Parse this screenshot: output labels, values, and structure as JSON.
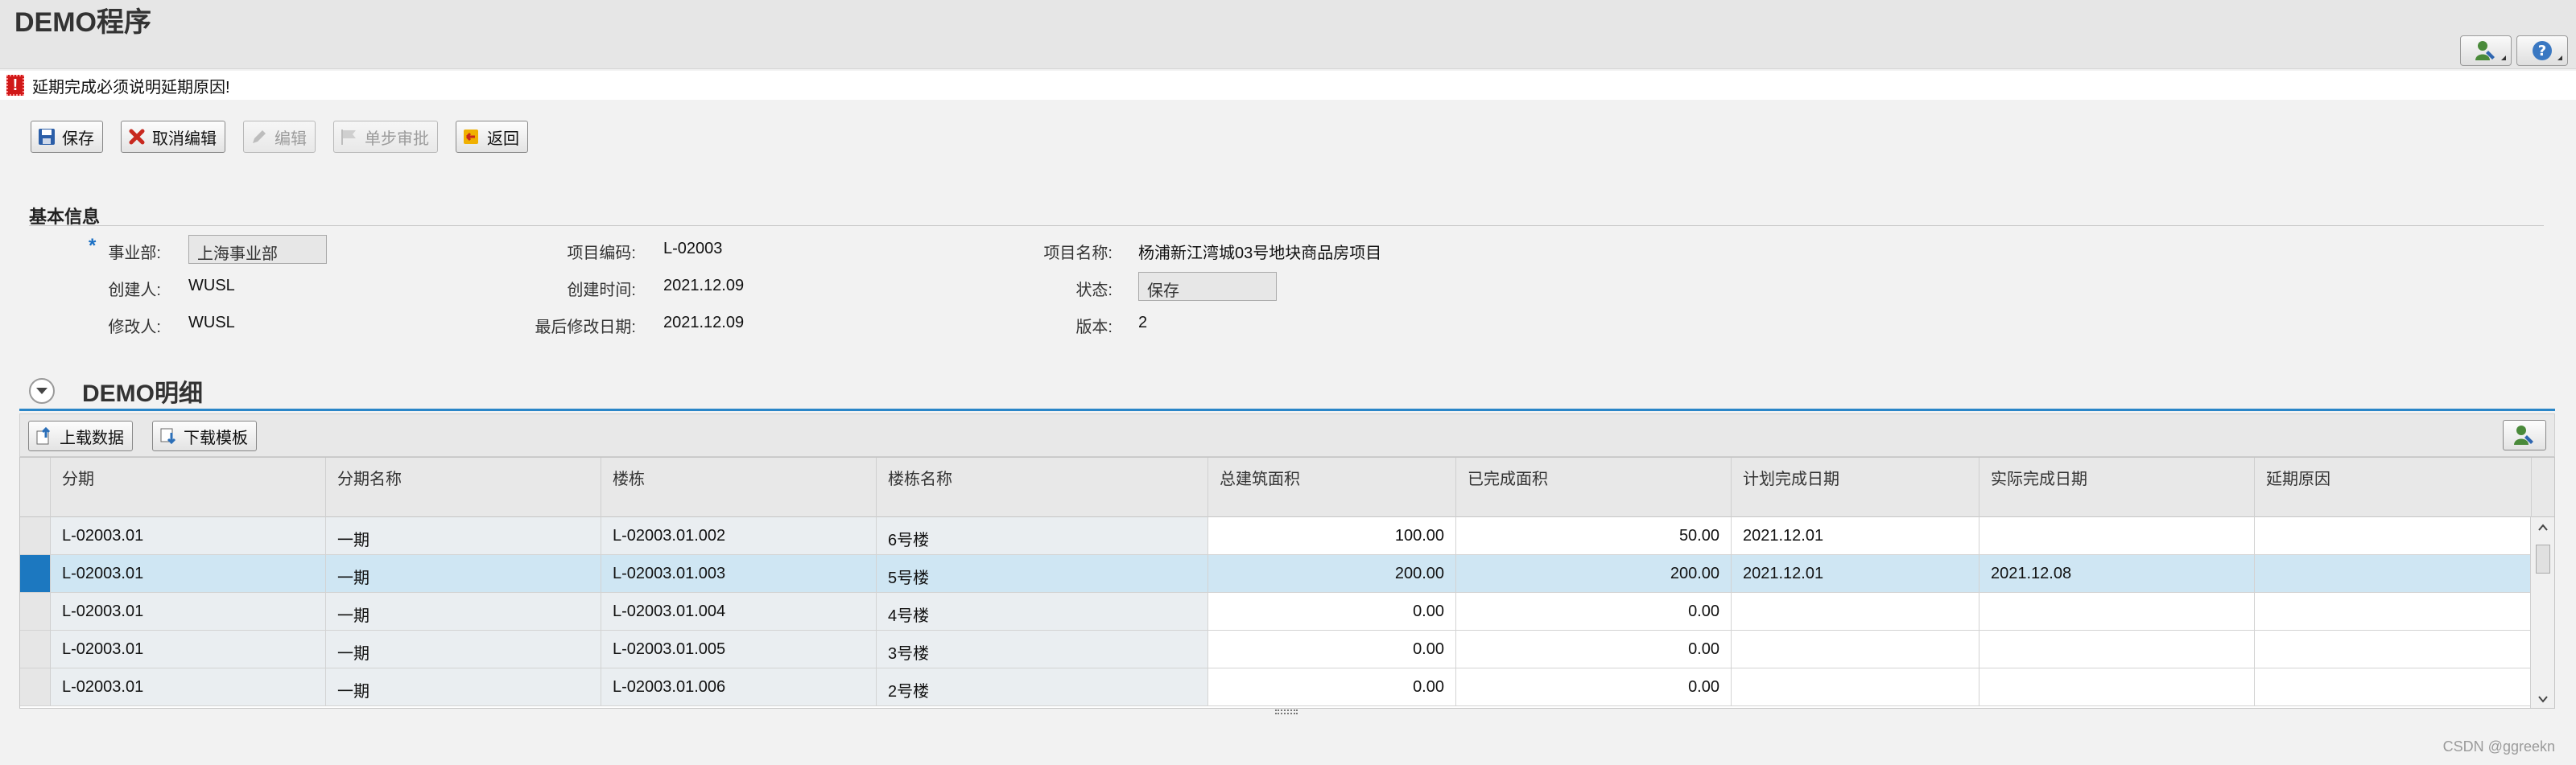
{
  "app": {
    "title": "DEMO程序"
  },
  "message": {
    "text": "延期完成必须说明延期原因!"
  },
  "toolbar": {
    "save": "保存",
    "cancel_edit": "取消编辑",
    "edit": "编辑",
    "single_approve": "单步审批",
    "back": "返回"
  },
  "basic_info": {
    "title": "基本信息",
    "business_unit_label": "事业部:",
    "business_unit_value": "上海事业部",
    "project_code_label": "项目编码:",
    "project_code_value": "L-02003",
    "project_name_label": "项目名称:",
    "project_name_value": "杨浦新江湾城03号地块商品房项目",
    "creator_label": "创建人:",
    "creator_value": "WUSL",
    "created_time_label": "创建时间:",
    "created_time_value": "2021.12.09",
    "status_label": "状态:",
    "status_value": "保存",
    "modifier_label": "修改人:",
    "modifier_value": "WUSL",
    "last_modified_label": "最后修改日期:",
    "last_modified_value": "2021.12.09",
    "version_label": "版本:",
    "version_value": "2"
  },
  "detail": {
    "title": "DEMO明细",
    "upload_label": "上载数据",
    "download_label": "下载模板",
    "columns": [
      "分期",
      "分期名称",
      "楼栋",
      "楼栋名称",
      "总建筑面积",
      "已完成面积",
      "计划完成日期",
      "实际完成日期",
      "延期原因"
    ],
    "rows": [
      [
        "L-02003.01",
        "一期",
        "L-02003.01.002",
        "6号楼",
        "100.00",
        "50.00",
        "2021.12.01",
        "",
        ""
      ],
      [
        "L-02003.01",
        "一期",
        "L-02003.01.003",
        "5号楼",
        "200.00",
        "200.00",
        "2021.12.01",
        "2021.12.08",
        ""
      ],
      [
        "L-02003.01",
        "一期",
        "L-02003.01.004",
        "4号楼",
        "0.00",
        "0.00",
        "",
        "",
        ""
      ],
      [
        "L-02003.01",
        "一期",
        "L-02003.01.005",
        "3号楼",
        "0.00",
        "0.00",
        "",
        "",
        ""
      ],
      [
        "L-02003.01",
        "一期",
        "L-02003.01.006",
        "2号楼",
        "0.00",
        "0.00",
        "",
        "",
        ""
      ]
    ],
    "selected_row": 1
  },
  "watermark": "CSDN @ggreekn"
}
